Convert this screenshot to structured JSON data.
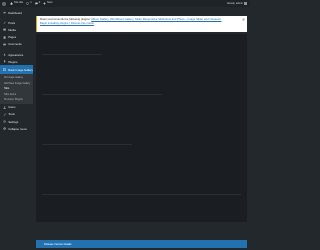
{
  "admin_bar": {
    "site_name": "Site title",
    "updates": "1",
    "comments": "0",
    "new_label": "New",
    "account": "Howdy, admin"
  },
  "sidebar": {
    "items": [
      {
        "label": "Dashboard",
        "icon": "dashboard-icon"
      },
      {
        "label": "Posts",
        "icon": "posts-icon"
      },
      {
        "label": "Media",
        "icon": "media-icon"
      },
      {
        "label": "Pages",
        "icon": "pages-icon"
      },
      {
        "label": "Comments",
        "icon": "comments-icon"
      },
      {
        "label": "Appearance",
        "icon": "appearance-icon"
      },
      {
        "label": "Plugins",
        "icon": "plugins-icon"
      },
      {
        "label": "Users",
        "icon": "users-icon"
      }
    ],
    "current": {
      "label": "Rank Image Gallery",
      "icon": "gallery-icon"
    },
    "submenu": [
      "All Image Gallery",
      "Add New Image Gallery",
      "Tabs",
      "Tabs Items",
      "Premium Plugins"
    ],
    "after_items": [
      {
        "label": "Users",
        "icon": "users-icon"
      },
      {
        "label": "Tools",
        "icon": "tools-icon"
      },
      {
        "label": "Settings",
        "icon": "settings-icon"
      },
      {
        "label": "Collapse menu",
        "icon": "collapse-icon"
      }
    ]
  },
  "notice": {
    "text_prefix": "Rutor recommends the following plugins:",
    "links": "Album Gallery, WordPress Gallery, Slider Responsive Slideshow and Photo – Image Slider and Carousel.",
    "link2": "Begin installing plugins | Dismiss this notice"
  },
  "footer_bar": {
    "label": "Release Version Details"
  },
  "colors": {
    "accent": "#2271b1",
    "sidebar_bg": "#23282d",
    "notice_border": "#dba617"
  }
}
